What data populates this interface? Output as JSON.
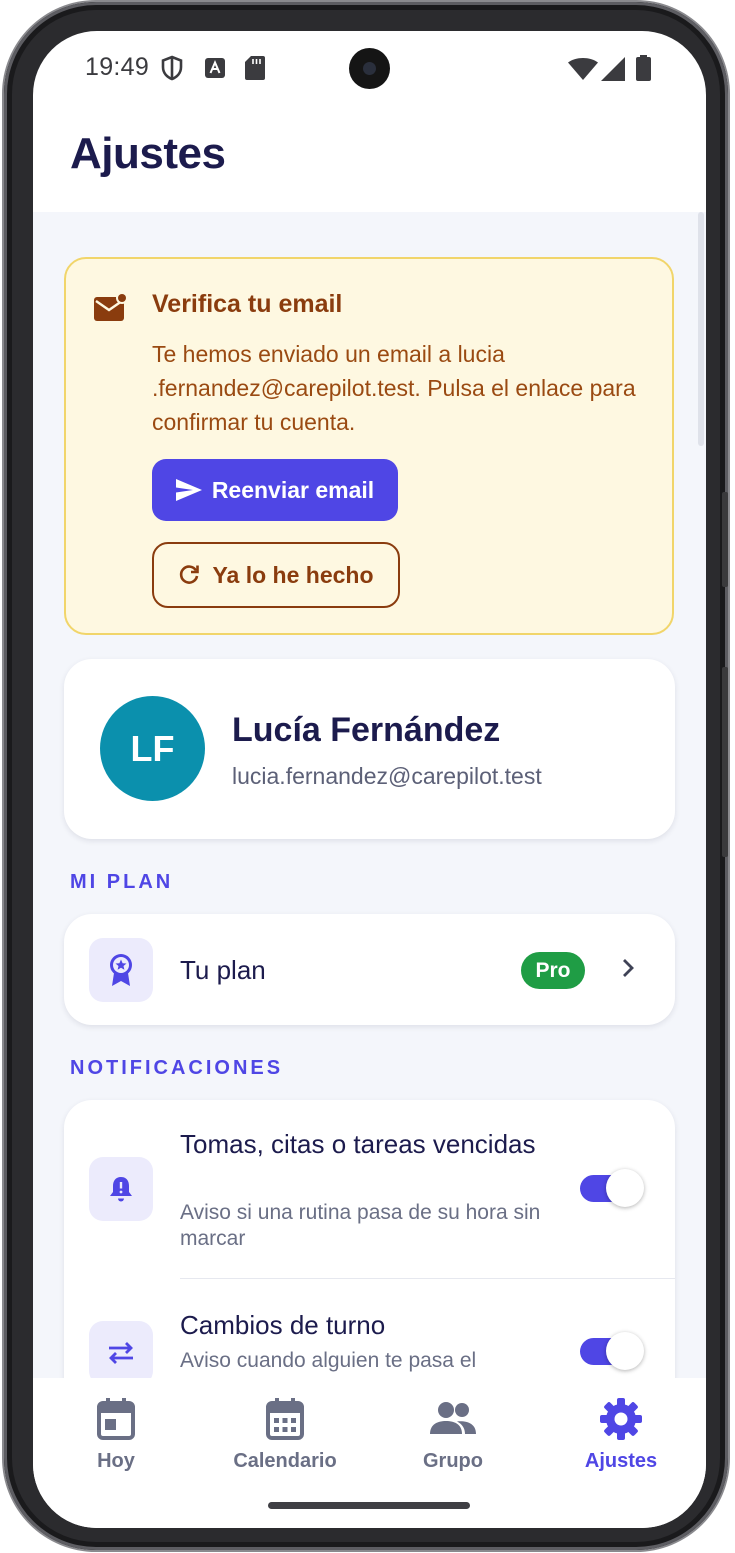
{
  "status_bar": {
    "time": "19:49",
    "icons": [
      "shield-icon",
      "font-a-icon",
      "sd-card-icon",
      "wifi-icon",
      "signal-icon",
      "battery-icon"
    ]
  },
  "header": {
    "title": "Ajustes"
  },
  "verify_banner": {
    "icon": "mail-badge-icon",
    "title": "Verifica tu email",
    "text": "Te hemos enviado un email a lucia .fernandez@carepilot.test. Pulsa el enlace para confirmar tu cuenta.",
    "resend_label": "Reenviar email",
    "done_label": "Ya lo he hecho"
  },
  "profile": {
    "initials": "LF",
    "name": "Lucía Fernández",
    "email": "lucia.fernandez@carepilot.test",
    "avatar_color": "#0b90ad"
  },
  "plan_section": {
    "label": "MI PLAN",
    "item_label": "Tu plan",
    "badge": "Pro",
    "badge_color": "#1f9d45"
  },
  "notifications_section": {
    "label": "NOTIFICACIONES",
    "items": [
      {
        "title": "Tomas, citas o tareas vencidas",
        "subtitle": "Aviso si una rutina pasa de su hora sin marcar",
        "enabled": true,
        "icon": "bell-alert-icon"
      },
      {
        "title": "Cambios de turno",
        "subtitle": "Aviso cuando alguien te pasa el",
        "enabled": true,
        "icon": "swap-arrows-icon"
      }
    ]
  },
  "bottom_nav": {
    "items": [
      {
        "label": "Hoy",
        "icon": "calendar-day-icon",
        "active": false
      },
      {
        "label": "Calendario",
        "icon": "calendar-month-icon",
        "active": false
      },
      {
        "label": "Grupo",
        "icon": "group-icon",
        "active": false
      },
      {
        "label": "Ajustes",
        "icon": "gear-icon",
        "active": true
      }
    ]
  },
  "colors": {
    "accent": "#4f46e5",
    "title": "#1c1b4d",
    "banner_bg": "#fef8e1",
    "banner_text": "#8a3c0e"
  }
}
